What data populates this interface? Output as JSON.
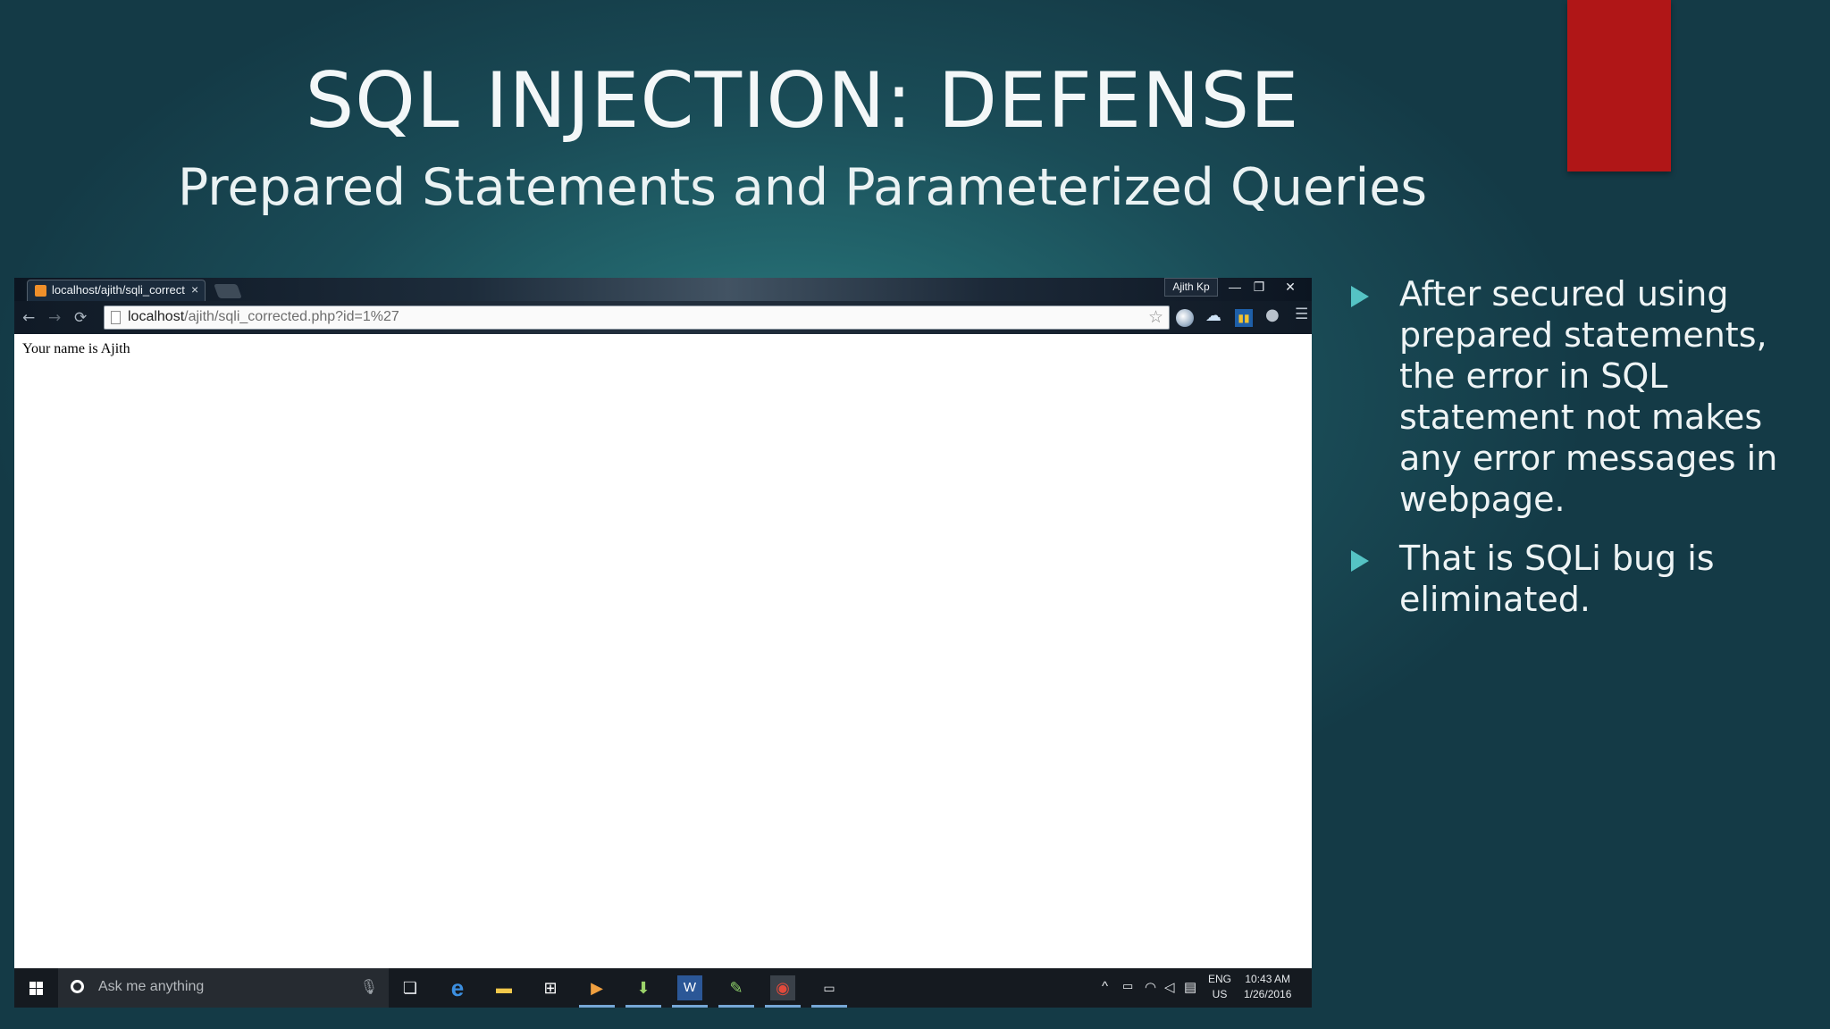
{
  "slide": {
    "title": "SQL INJECTION: DEFENSE",
    "subtitle": "Prepared Statements and Parameterized Queries",
    "accent_color": "#b01617",
    "bullet_color": "#55c3c4",
    "bullets": [
      {
        "text": "After secured using prepared statements, the error in SQL statement not makes any error messages in webpage."
      },
      {
        "text": "That is SQLi bug is eliminated."
      }
    ]
  },
  "browser": {
    "tab_title": "localhost/ajith/sqli_correct",
    "tab_close": "×",
    "profile_name": "Ajith Kp",
    "window_controls": {
      "minimize": "—",
      "restore": "❐",
      "close": "✕"
    },
    "nav": {
      "back": "←",
      "forward": "→",
      "reload": "⟳"
    },
    "url_host": "localhost",
    "url_path": "/ajith/sqli_corrected.php?id=1%27",
    "star": "☆",
    "extensions": [
      "globe-icon",
      "cloud-icon",
      "chart-icon",
      "person-icon",
      "menu-icon"
    ],
    "page_text": "Your name is Ajith"
  },
  "taskbar": {
    "search_placeholder": "Ask me anything",
    "apps": [
      "task-view-icon",
      "edge-icon",
      "file-explorer-icon",
      "store-icon",
      "media-player-icon",
      "downloads-icon",
      "word-icon",
      "notepad-icon",
      "chrome-icon",
      "terminal-icon"
    ],
    "lang_line1": "ENG",
    "lang_line2": "US",
    "time": "10:43 AM",
    "date": "1/26/2016"
  }
}
